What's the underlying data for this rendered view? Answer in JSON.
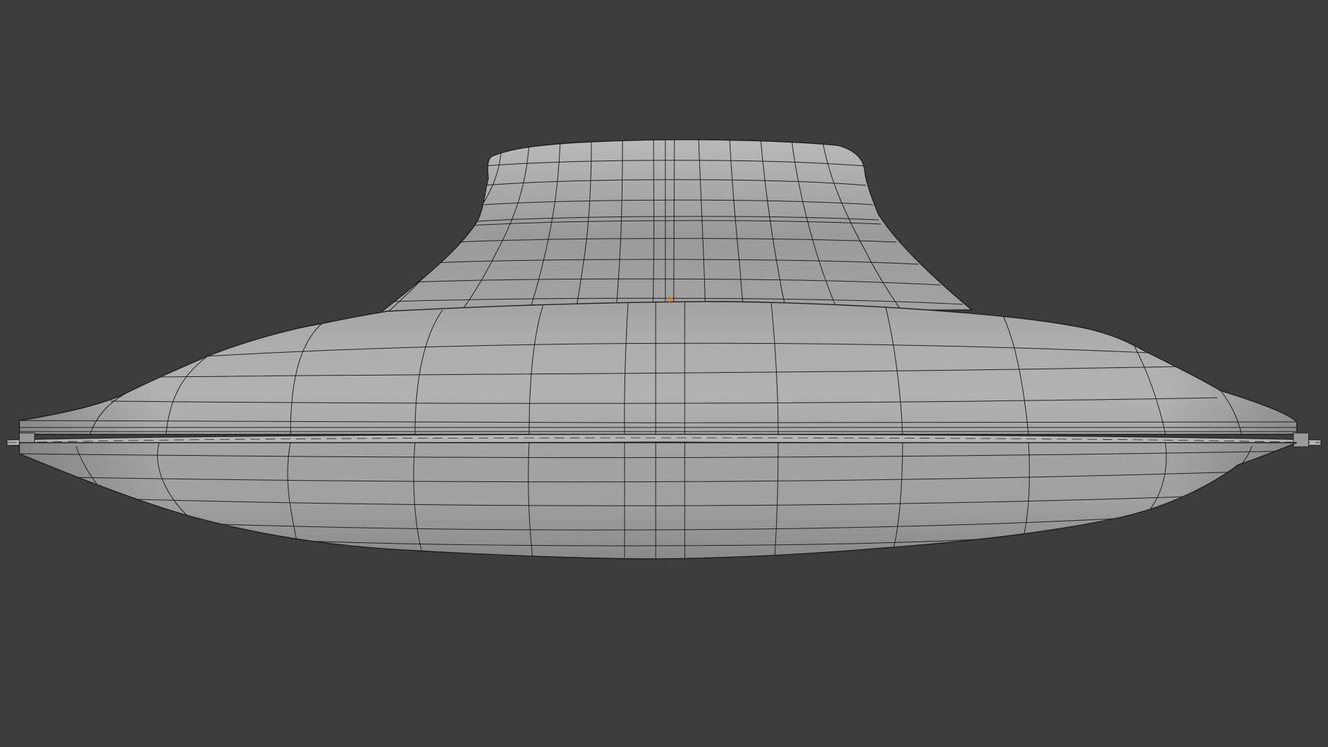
{
  "viewport": {
    "background_color": "#3d3d3d",
    "object": {
      "kind": "flying-saucer-mesh",
      "shading": "solid",
      "wireframe_overlay": true,
      "surface_color": "#a5a5a5",
      "wire_color": "#1e1e1e",
      "origin_color": "#e08a1e"
    }
  }
}
